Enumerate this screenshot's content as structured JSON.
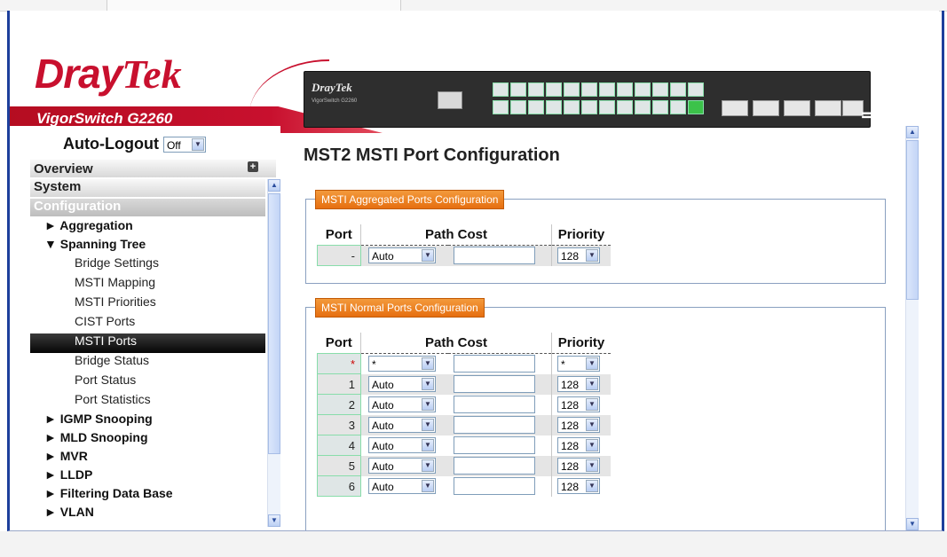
{
  "header": {
    "brand_dray": "Dray",
    "brand_tek": "Tek",
    "model": "VigorSwitch G2260",
    "device_brand": "DrayTek",
    "device_model": "VigorSwitch G2260",
    "logout_icon": "logout-arrow-icon",
    "help_label": "?"
  },
  "sidebar": {
    "autologout_label": "Auto-Logout",
    "autologout_value": "Off",
    "overview": "Overview",
    "system": "System",
    "configuration": "Configuration",
    "groups": [
      {
        "label": "► Aggregation"
      },
      {
        "label": "▼ Spanning Tree"
      }
    ],
    "spanning_items": [
      "Bridge Settings",
      "MSTI Mapping",
      "MSTI Priorities",
      "CIST Ports",
      "MSTI Ports",
      "Bridge Status",
      "Port Status",
      "Port Statistics"
    ],
    "more_groups": [
      "► IGMP Snooping",
      "► MLD Snooping",
      "► MVR",
      "► LLDP",
      "► Filtering Data Base",
      "► VLAN"
    ]
  },
  "main": {
    "title": "MST2 MSTI Port Configuration",
    "agg": {
      "legend": "MSTI Aggregated Ports Configuration",
      "col_port": "Port",
      "col_pathcost": "Path Cost",
      "col_priority": "Priority",
      "row": {
        "port": "-",
        "pathcost": "Auto",
        "priority": "128"
      }
    },
    "normal": {
      "legend": "MSTI Normal Ports Configuration",
      "col_port": "Port",
      "col_pathcost": "Path Cost",
      "col_priority": "Priority",
      "rows": [
        {
          "port": "*",
          "pathcost": "*",
          "priority": "*"
        },
        {
          "port": "1",
          "pathcost": "Auto",
          "priority": "128"
        },
        {
          "port": "2",
          "pathcost": "Auto",
          "priority": "128"
        },
        {
          "port": "3",
          "pathcost": "Auto",
          "priority": "128"
        },
        {
          "port": "4",
          "pathcost": "Auto",
          "priority": "128"
        },
        {
          "port": "5",
          "pathcost": "Auto",
          "priority": "128"
        },
        {
          "port": "6",
          "pathcost": "Auto",
          "priority": "128"
        }
      ]
    }
  },
  "colors": {
    "brand_red": "#c8102e",
    "frame_blue": "#1d3f9c",
    "legend_orange": "#e66f10"
  }
}
